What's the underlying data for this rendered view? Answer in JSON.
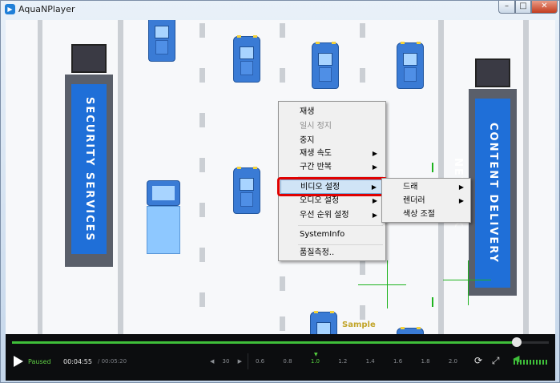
{
  "window": {
    "title": "AquaNPlayer",
    "app_icon": "aquanplayer-app-icon",
    "min": "–",
    "max": "□",
    "close": "✕"
  },
  "video": {
    "watermark": "Sample",
    "truck_left_text": "SECURITY SERVICES",
    "truck_right_text": "CONTENT DELIVERY NETWORK"
  },
  "context_menu": {
    "items": [
      {
        "label": "재생",
        "disabled": false,
        "submenu": false
      },
      {
        "label": "일시 정지",
        "disabled": true,
        "submenu": false
      },
      {
        "label": "중지",
        "disabled": false,
        "submenu": false
      },
      {
        "label": "재생 속도",
        "disabled": false,
        "submenu": true
      },
      {
        "label": "구간 반복",
        "disabled": false,
        "submenu": true
      },
      {
        "label": "비디오 설정",
        "disabled": false,
        "submenu": true,
        "selected": true
      },
      {
        "label": "오디오 설정",
        "disabled": false,
        "submenu": true
      },
      {
        "label": "우선 순위 설정",
        "disabled": false,
        "submenu": true
      },
      {
        "label": "SystemInfo",
        "disabled": false,
        "submenu": false
      },
      {
        "label": "품질측정..",
        "disabled": false,
        "submenu": false
      }
    ]
  },
  "submenu": {
    "items": [
      {
        "label": "드래",
        "submenu": true
      },
      {
        "label": "렌더러",
        "submenu": true
      },
      {
        "label": "색상 조절",
        "submenu": false
      }
    ]
  },
  "player": {
    "status": "Paused",
    "current_time": "00:04:55",
    "total_time": "/ 00:05:20",
    "progress": 0.94,
    "skip_seconds": "30",
    "speeds": [
      "0.6",
      "0.8",
      "1.0",
      "1.2",
      "1.4",
      "1.6",
      "1.8",
      "2.0"
    ],
    "current_speed": "1.0",
    "volume_level": 1.0
  },
  "colors": {
    "accent": "#3fbf3a",
    "highlight_box": "#e00000",
    "menu_selected": "#d0e4f6"
  }
}
